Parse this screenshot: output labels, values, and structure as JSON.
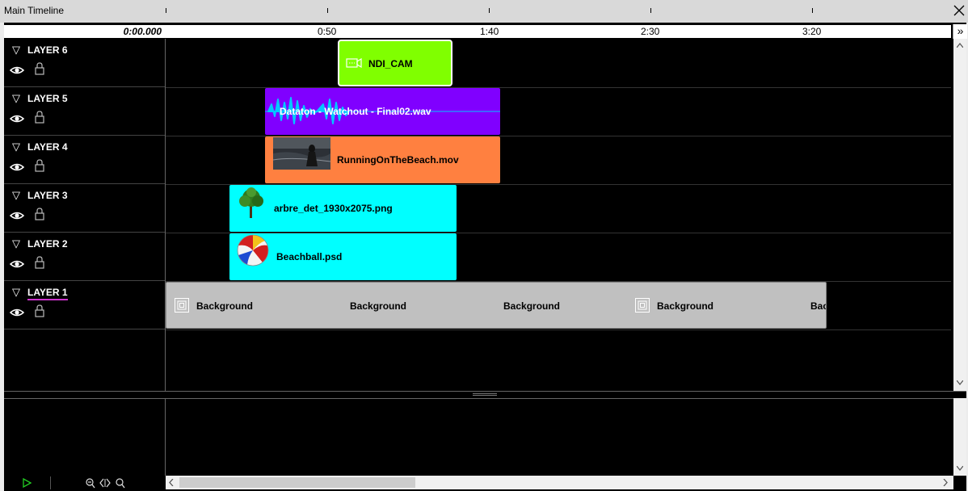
{
  "window": {
    "title": "Main Timeline"
  },
  "ruler": {
    "origin": "0:00.000",
    "ticks": [
      "0:50",
      "1:40",
      "2:30",
      "3:20"
    ],
    "expand_glyph": "»"
  },
  "layers": [
    {
      "name": "LAYER 6"
    },
    {
      "name": "LAYER 5"
    },
    {
      "name": "LAYER 4"
    },
    {
      "name": "LAYER 3"
    },
    {
      "name": "LAYER 2"
    },
    {
      "name": "LAYER 1"
    }
  ],
  "cues": {
    "ndi": {
      "label": "NDI_CAM",
      "color": "#80ff00",
      "icon": "video-camera-icon"
    },
    "audio": {
      "label": "Dataton - Watchout - Final02.wav",
      "color": "#8000ff",
      "icon": "waveform-icon"
    },
    "video": {
      "label": "RunningOnTheBeach.mov",
      "color": "#ff8040",
      "icon": "video-thumbnail"
    },
    "tree": {
      "label": "arbre_det_1930x2075.png",
      "color": "#00ffff",
      "icon": "tree-thumbnail"
    },
    "ball": {
      "label": "Beachball.psd",
      "color": "#00ffff",
      "icon": "beachball-thumbnail"
    },
    "background": {
      "color": "#c0c0c0",
      "icon": "composition-icon",
      "labels": [
        "Background",
        "Background",
        "Background",
        "Background",
        "Bac"
      ]
    }
  },
  "colors": {
    "selected_layer_underline": "#cc33cc",
    "panel_bg": "#000000"
  }
}
